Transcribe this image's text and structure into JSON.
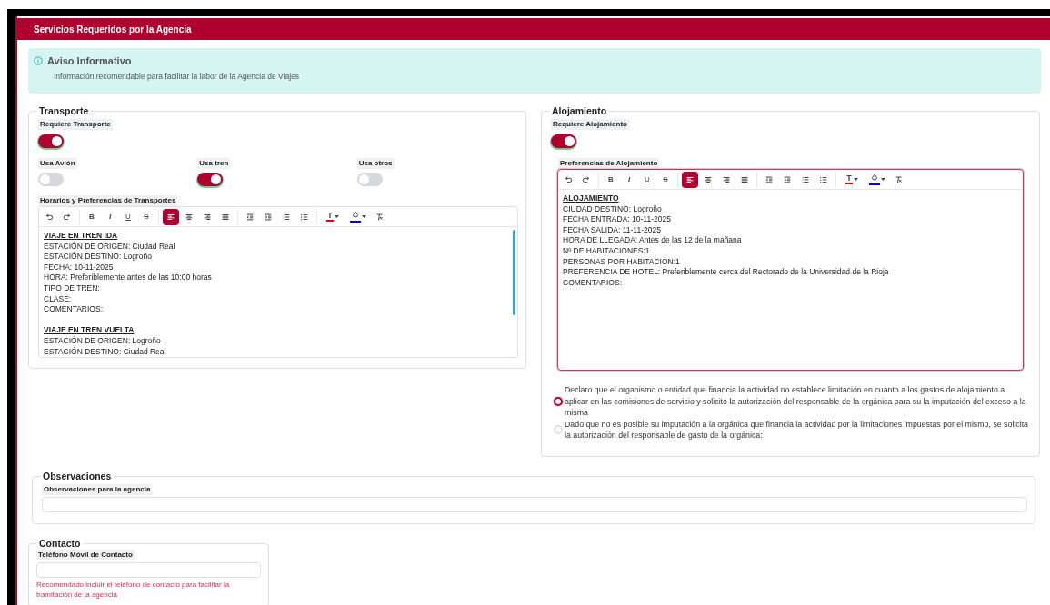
{
  "header": {
    "title": "Servicios Requeridos por la Agencia"
  },
  "notice": {
    "title": "Aviso Informativo",
    "text": "Información recomendable para facilitar la labor de la Agencia de Viajes"
  },
  "transport": {
    "legend": "Transporte",
    "require": {
      "label": "Requiere Transporte",
      "on": true
    },
    "modes": [
      {
        "label": "Usa Avión",
        "on": false
      },
      {
        "label": "Usa tren",
        "on": true
      },
      {
        "label": "Usa otros",
        "on": false
      }
    ],
    "editor": {
      "label": "Horarios y Preferencias de Transportes",
      "focused": false,
      "scrollbar": true,
      "toolbar": [
        {
          "kind": "undo",
          "selected": false
        },
        {
          "kind": "redo",
          "selected": false
        },
        {
          "kind": "bold",
          "label": "B",
          "selected": false
        },
        {
          "kind": "italic",
          "label": "I",
          "selected": false
        },
        {
          "kind": "underline",
          "label": "U",
          "selected": false
        },
        {
          "kind": "strike",
          "label": "S",
          "selected": false
        },
        {
          "kind": "align-left",
          "selected": true
        },
        {
          "kind": "align-center",
          "selected": false
        },
        {
          "kind": "align-right",
          "selected": false
        },
        {
          "kind": "justify",
          "selected": false
        },
        {
          "kind": "outdent",
          "selected": false
        },
        {
          "kind": "indent",
          "selected": false
        },
        {
          "kind": "bullets",
          "selected": false
        },
        {
          "kind": "numbers",
          "selected": false
        },
        {
          "kind": "text-color",
          "label": "T",
          "color": "#e00000",
          "selected": false
        },
        {
          "kind": "highlight",
          "color": "#0000e0",
          "selected": false
        },
        {
          "kind": "clear",
          "selected": false
        }
      ],
      "blocks": [
        {
          "heading": "VIAJE EN TREN IDA",
          "lines": [
            "ESTACIÓN DE ORIGEN: Ciudad Real",
            "ESTACIÓN DESTINO: Logroño",
            "FECHA: 10-11-2025",
            "HORA: Preferiblemente antes de las 10:00 horas",
            "TIPO DE TREN:",
            "CLASE:",
            "COMENTARIOS:"
          ]
        },
        {
          "heading": "VIAJE EN TREN VUELTA",
          "lines": [
            "ESTACIÓN DE ORIGEN: Logroño",
            "ESTACIÓN DESTINO: Ciudad Real"
          ]
        }
      ]
    }
  },
  "lodging": {
    "legend": "Alojamiento",
    "require": {
      "label": "Requiere Alojamiento",
      "on": true
    },
    "editor": {
      "label": "Preferencias de Alojamiento",
      "focused": true,
      "scrollbar": false,
      "toolbar": [
        {
          "kind": "undo",
          "selected": false
        },
        {
          "kind": "redo",
          "selected": false
        },
        {
          "kind": "bold",
          "label": "B",
          "selected": false
        },
        {
          "kind": "italic",
          "label": "I",
          "selected": false
        },
        {
          "kind": "underline",
          "label": "U",
          "selected": false
        },
        {
          "kind": "strike",
          "label": "S",
          "selected": false
        },
        {
          "kind": "align-left",
          "selected": true
        },
        {
          "kind": "align-center",
          "selected": false
        },
        {
          "kind": "align-right",
          "selected": false
        },
        {
          "kind": "justify",
          "selected": false
        },
        {
          "kind": "outdent",
          "selected": false
        },
        {
          "kind": "indent",
          "selected": false
        },
        {
          "kind": "bullets",
          "selected": false
        },
        {
          "kind": "numbers",
          "selected": false
        },
        {
          "kind": "text-color",
          "label": "T",
          "color": "#e00000",
          "selected": false
        },
        {
          "kind": "highlight",
          "color": "#0000e0",
          "selected": false
        },
        {
          "kind": "clear",
          "selected": false
        }
      ],
      "blocks": [
        {
          "heading": "ALOJAMIENTO",
          "lines": [
            "CIUDAD DESTINO: Logroño",
            "FECHA ENTRADA: 10-11-2025",
            "FECHA SALIDA: 11-11-2025",
            "HORA DE LLEGADA: Antes de las 12 de la mañana",
            "Nº DE HABITACIONES:1",
            "PERSONAS POR HABITACIÓN:1",
            "PREFERENCIA DE HOTEL: Preferiblemente cerca del Rectorado de la Universidad de la Rioja",
            "COMENTARIOS:"
          ]
        }
      ]
    },
    "options": [
      {
        "text": "Declaro que el organismo o entidad que financia la actividad no establece limitación en cuanto a los gastos de alojamiento a aplicar en las comisiones de servicio y solicito la autorización del responsable de la orgánica para su la imputación del exceso a la misma",
        "selected": true
      },
      {
        "text": "Dado que no es posible su imputación a la orgánica que financia la actividad por la limitaciones impuestas por el mismo, se solicita la autorización del responsable de gasto de la orgánica:",
        "selected": false
      }
    ]
  },
  "observations": {
    "legend": "Observaciones",
    "label": "Observaciones para la agencia"
  },
  "contact": {
    "legend": "Contacto",
    "label": "Teléfono Móvil de Contacto",
    "hint": "Recomendado incluir el teléfono de contacto para facilitar la tramitación de la agencia"
  }
}
